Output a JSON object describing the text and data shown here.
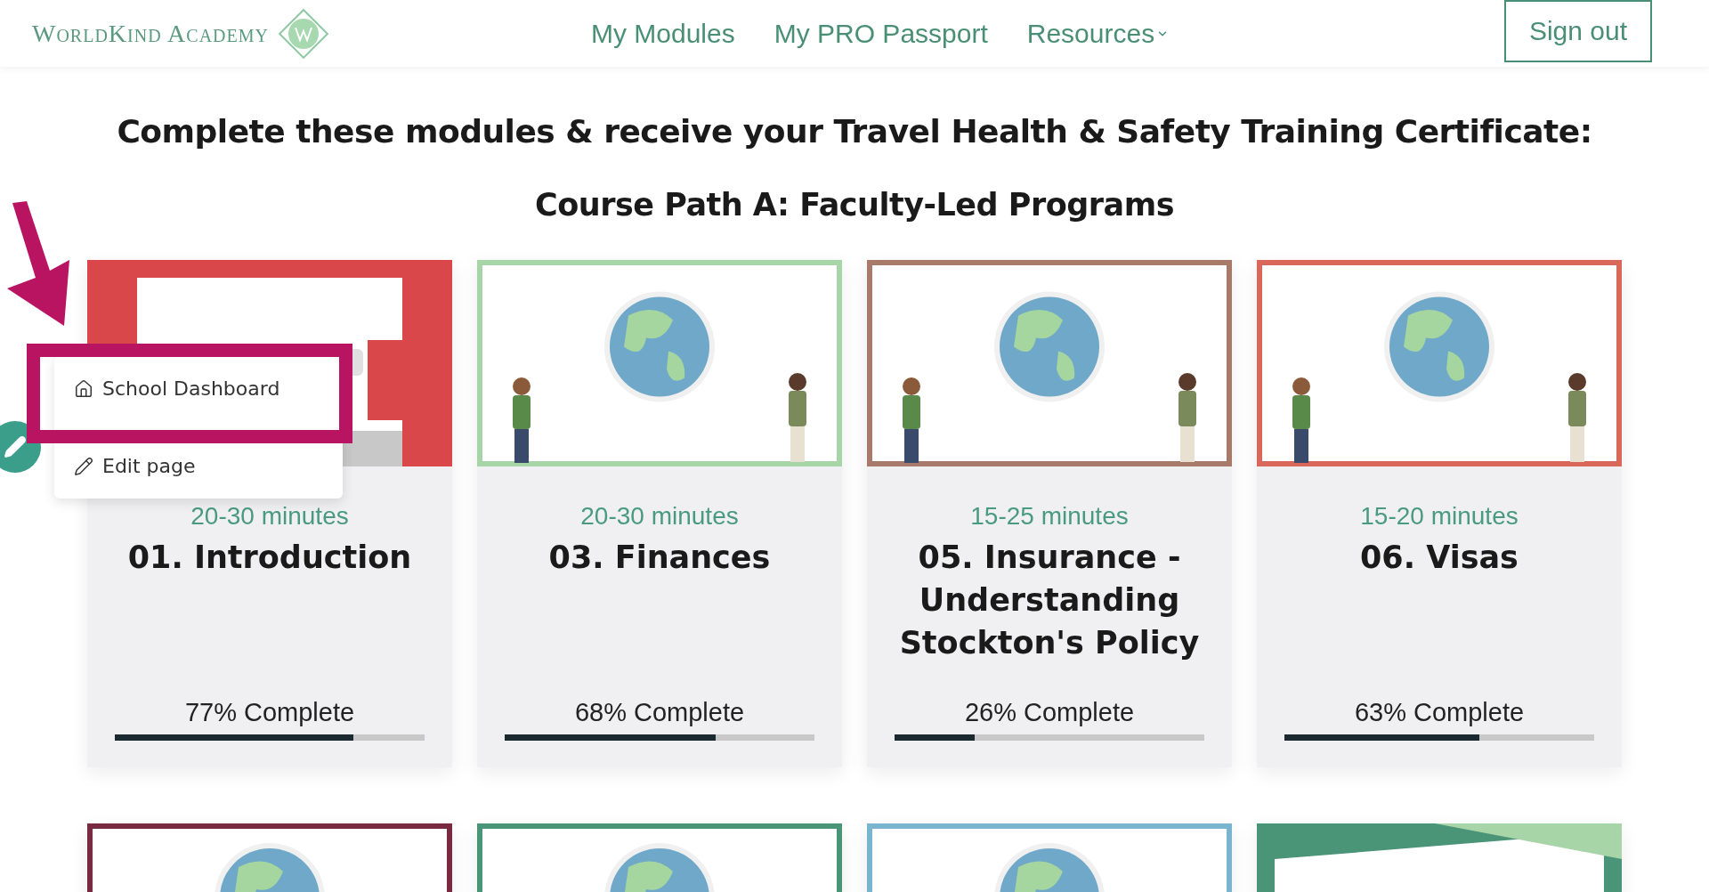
{
  "header": {
    "logo": "WorldKind Academy",
    "nav": [
      {
        "label": "My Modules",
        "dropdown": false
      },
      {
        "label": "My PRO Passport",
        "dropdown": false
      },
      {
        "label": "Resources",
        "dropdown": true
      }
    ],
    "sign_out": "Sign out"
  },
  "heading": "Complete these modules & receive your Travel Health & Safety Training Certificate:",
  "path_title": "Course Path A: Faculty-Led Programs",
  "modules": [
    {
      "duration": "20-30 minutes",
      "title": "01. Introduction",
      "progress": "77% Complete",
      "level": 0.77
    },
    {
      "duration": "20-30 minutes",
      "title": "03. Finances",
      "progress": "68% Complete",
      "level": 0.68
    },
    {
      "duration": "15-25 minutes",
      "title": "05. Insurance - Understanding Stockton's Policy",
      "progress": "26% Complete",
      "level": 0.26
    },
    {
      "duration": "15-20 minutes",
      "title": "06. Visas",
      "progress": "63% Complete",
      "level": 0.63
    }
  ],
  "edit_menu": {
    "items": [
      {
        "label": "School Dashboard"
      },
      {
        "label": "Edit page"
      }
    ]
  }
}
